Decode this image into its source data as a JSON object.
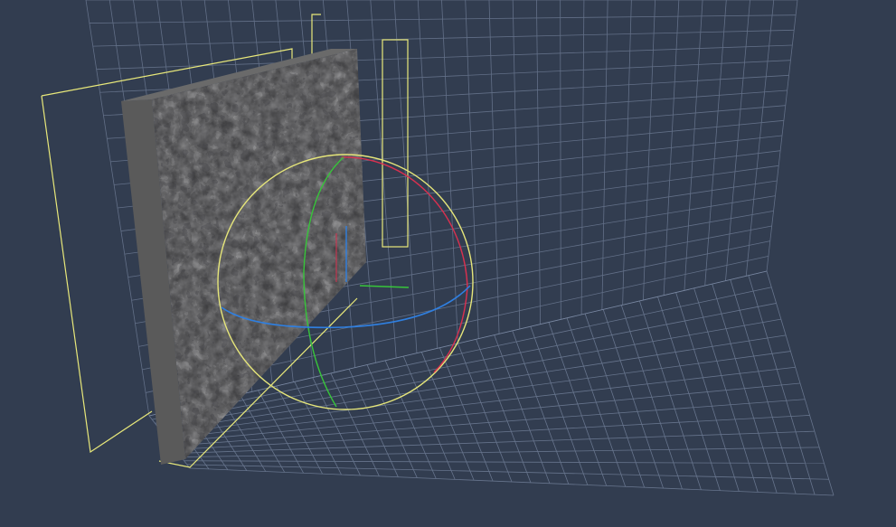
{
  "viewport": {
    "background": "#323d50",
    "grid_color": "#8a99b5",
    "selection_color": "#e8e87a"
  },
  "scene": {
    "object": "textured-wall-panel",
    "panel_face_color": "#3a3a3c",
    "panel_edge_color": "#5a5a5a"
  },
  "gizmo": {
    "type": "rotate-gizmo",
    "ring_x_color": "#d9304f",
    "ring_y_color": "#37c53a",
    "ring_z_color": "#2f7fe0",
    "outer_ring_color": "#e6e67a"
  }
}
